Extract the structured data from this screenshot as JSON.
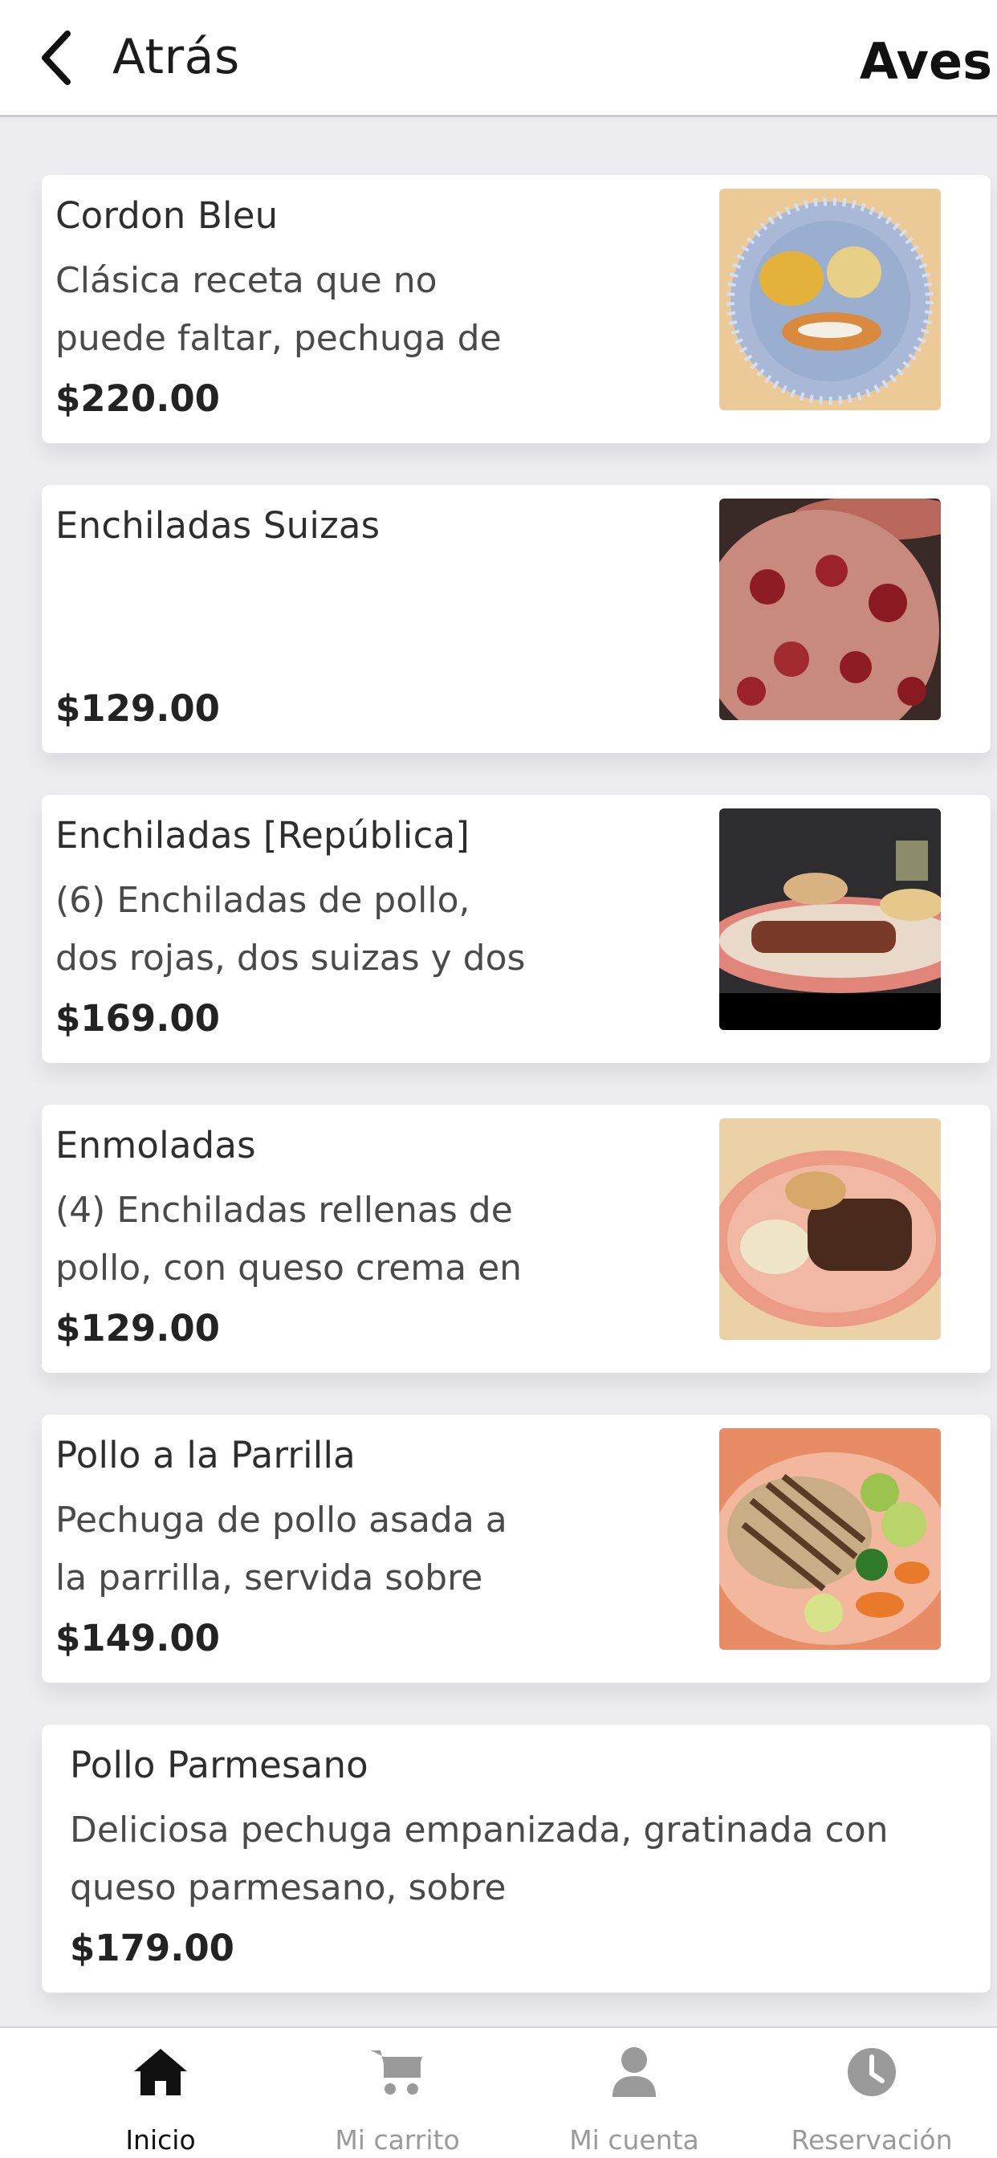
{
  "header": {
    "back_label": "Atrás",
    "title": "Aves",
    "back_icon": "chevron-left-icon"
  },
  "items": [
    {
      "name": "Cordon Bleu",
      "description": "Clásica receta que no puede faltar, pechuga de",
      "price": "$220.00",
      "image": "cordon-bleu-photo"
    },
    {
      "name": "Enchiladas Suizas",
      "description": "",
      "price": "$129.00",
      "image": "enchiladas-suizas-photo"
    },
    {
      "name": "Enchiladas [República]",
      "description": "(6) Enchiladas de pollo, dos rojas, dos suizas y dos",
      "price": "$169.00",
      "image": "enchiladas-republica-photo"
    },
    {
      "name": "Enmoladas",
      "description": "(4) Enchiladas rellenas de pollo, con queso crema en",
      "price": "$129.00",
      "image": "enmoladas-photo"
    },
    {
      "name": "Pollo a la Parrilla",
      "description": "Pechuga de pollo asada a la parrilla, servida sobre",
      "price": "$149.00",
      "image": "pollo-parrilla-photo"
    },
    {
      "name": "Pollo Parmesano",
      "description": "Deliciosa pechuga empanizada, gratinada con queso parmesano, sobre",
      "price": "$179.00",
      "image": ""
    }
  ],
  "tabbar": {
    "tabs": [
      {
        "label": "Inicio",
        "icon": "home-icon",
        "active": true
      },
      {
        "label": "Mi carrito",
        "icon": "cart-icon",
        "active": false
      },
      {
        "label": "Mi cuenta",
        "icon": "user-icon",
        "active": false
      },
      {
        "label": "Reservación",
        "icon": "clock-icon",
        "active": false
      }
    ]
  },
  "colors": {
    "background": "#ededf0",
    "card": "#ffffff",
    "active_tab": "#111111",
    "inactive_tab": "#9a9a9a"
  }
}
